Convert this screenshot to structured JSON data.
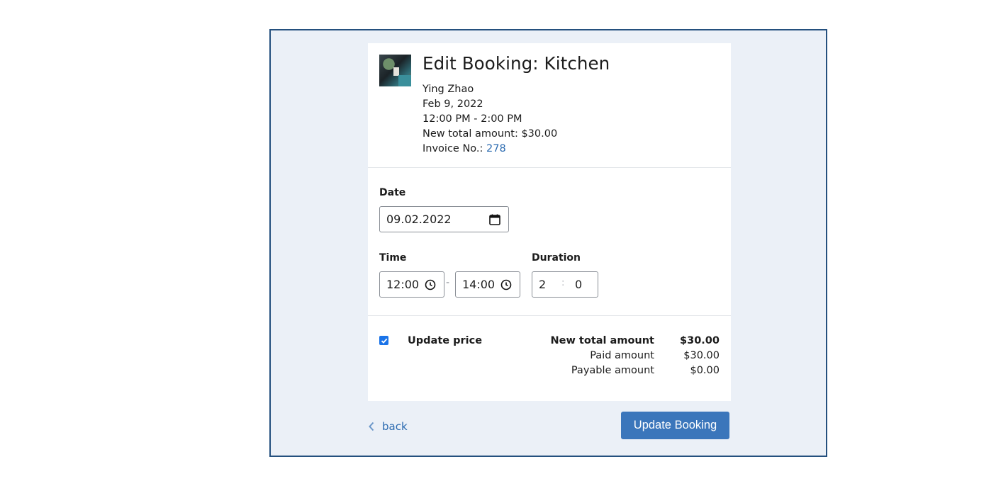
{
  "booking": {
    "title": "Edit Booking: Kitchen",
    "customer": "Ying Zhao",
    "date": "Feb 9, 2022",
    "time_range": "12:00 PM - 2:00 PM",
    "new_total_label": "New total amount:",
    "new_total_value": "$30.00",
    "invoice_label": "Invoice No.:",
    "invoice_number": "278"
  },
  "form": {
    "date_label": "Date",
    "date_value": "09.02.2022",
    "time_label": "Time",
    "time_start": "12:00",
    "time_end": "14:00",
    "time_separator": "-",
    "duration_label": "Duration",
    "duration_hours": "2",
    "duration_separator": ":",
    "duration_minutes": "0"
  },
  "price": {
    "update_price_label": "Update price",
    "update_price_checked": true,
    "rows": [
      {
        "label": "New total amount",
        "value": "$30.00"
      },
      {
        "label": "Paid amount",
        "value": "$30.00"
      },
      {
        "label": "Payable amount",
        "value": "$0.00"
      }
    ]
  },
  "footer": {
    "back_label": "back",
    "submit_label": "Update Booking"
  },
  "colors": {
    "accent": "#3b76bb",
    "link": "#2a6ab0",
    "frame_border": "#24507e",
    "frame_background": "#ebf0f7",
    "checkbox": "#1a73e8"
  },
  "icons": {
    "date_field": "calendar-icon",
    "time_fields": "clock-icon",
    "back": "chevron-left-icon",
    "checkbox": "check-icon"
  }
}
